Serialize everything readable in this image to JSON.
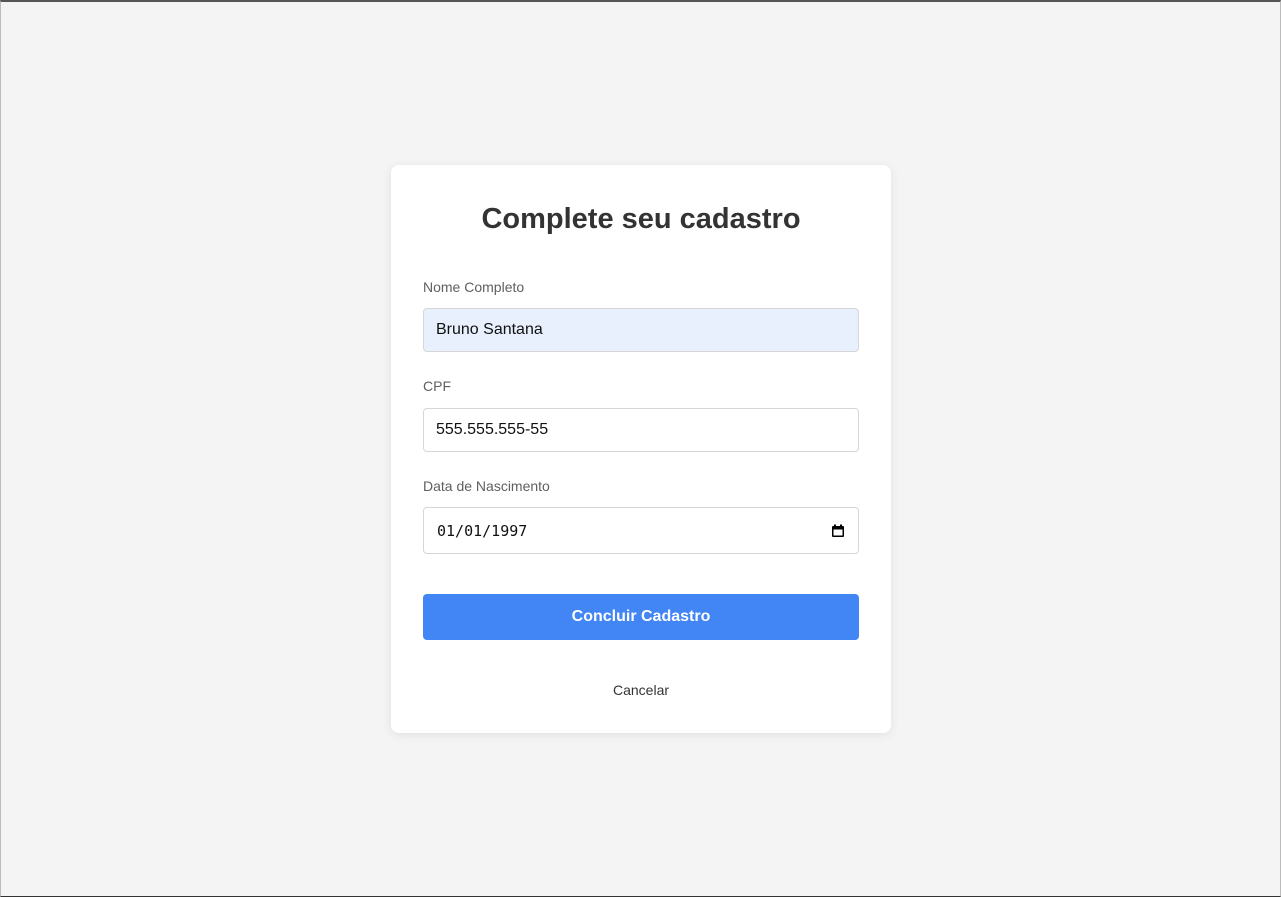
{
  "form": {
    "title": "Complete seu cadastro",
    "fields": {
      "name": {
        "label": "Nome Completo",
        "value": "Bruno Santana"
      },
      "cpf": {
        "label": "CPF",
        "value": "555.555.555-55"
      },
      "birthdate": {
        "label": "Data de Nascimento",
        "value": "01/01/1997",
        "icon": "calendar-icon"
      }
    },
    "submit_label": "Concluir Cadastro",
    "cancel_label": "Cancelar"
  },
  "colors": {
    "background": "#f4f4f4",
    "card": "#ffffff",
    "primary_button": "#4285f4",
    "autofill_background": "#e8f0fe",
    "title_text": "#333333",
    "label_text": "#5f5f5f"
  }
}
